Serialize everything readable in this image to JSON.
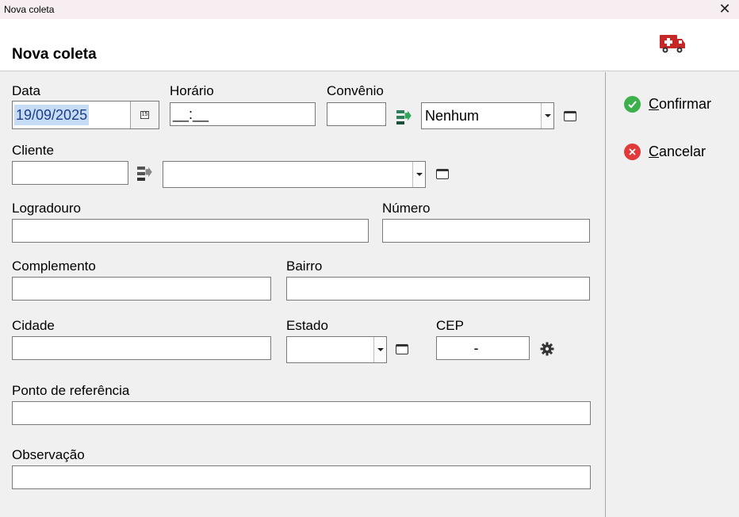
{
  "window": {
    "title": "Nova coleta",
    "close_label": "✕"
  },
  "header": {
    "heading": "Nova coleta",
    "icon": "ambulance-icon"
  },
  "form": {
    "data": {
      "label": "Data",
      "value": "19/09/2025",
      "cal_glyph": "15"
    },
    "horario": {
      "label": "Horário",
      "value": "__:__"
    },
    "convenio": {
      "label": "Convênio",
      "code_value": "",
      "selected": "Nenhum"
    },
    "cliente": {
      "label": "Cliente",
      "code_value": "",
      "selected": ""
    },
    "logradouro": {
      "label": "Logradouro",
      "value": ""
    },
    "numero": {
      "label": "Número",
      "value": ""
    },
    "complemento": {
      "label": "Complemento",
      "value": ""
    },
    "bairro": {
      "label": "Bairro",
      "value": ""
    },
    "cidade": {
      "label": "Cidade",
      "value": ""
    },
    "estado": {
      "label": "Estado",
      "selected": ""
    },
    "cep": {
      "label": "CEP",
      "value": "-"
    },
    "ponto_referencia": {
      "label": "Ponto de referência",
      "value": ""
    },
    "observacao": {
      "label": "Observação",
      "value": ""
    }
  },
  "actions": {
    "confirm": {
      "mnemonic": "C",
      "rest": "onfirmar",
      "color": "#3cb04a"
    },
    "cancel": {
      "mnemonic": "C",
      "rest": "ancelar",
      "color": "#e23a3a"
    }
  }
}
